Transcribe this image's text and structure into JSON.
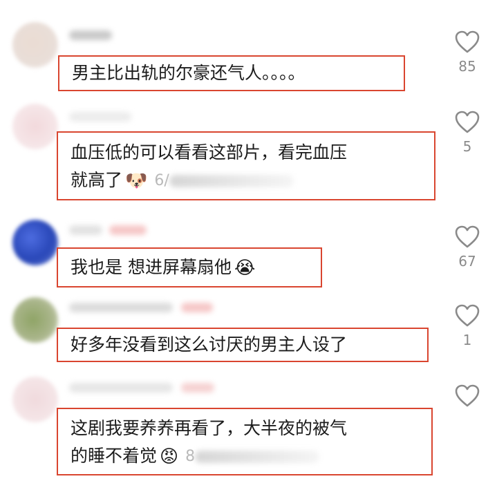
{
  "comments": [
    {
      "text": "男主比出轨的尔豪还气人。。。。",
      "likes": "85"
    },
    {
      "text_line1": "血压低的可以看看这部片，看完血压",
      "text_line2": "就高了",
      "emoji": "🐶",
      "time_partial": "6/",
      "likes": "5"
    },
    {
      "text": "我也是 想进屏幕扇他",
      "emoji": "😭",
      "likes": "67"
    },
    {
      "text": "好多年没看到这么讨厌的男主人设了",
      "likes": "1"
    },
    {
      "text_line1": "这剧我要养养再看了，大半夜的被气",
      "text_line2": "的睡不着觉",
      "emoji": "😡",
      "time_partial": "8",
      "likes": ""
    }
  ],
  "colors": {
    "highlight_border": "#d9452f",
    "text": "#1b1b1b",
    "meta": "#8a8a8a"
  },
  "icons": {
    "like": "heart-outline-icon"
  }
}
